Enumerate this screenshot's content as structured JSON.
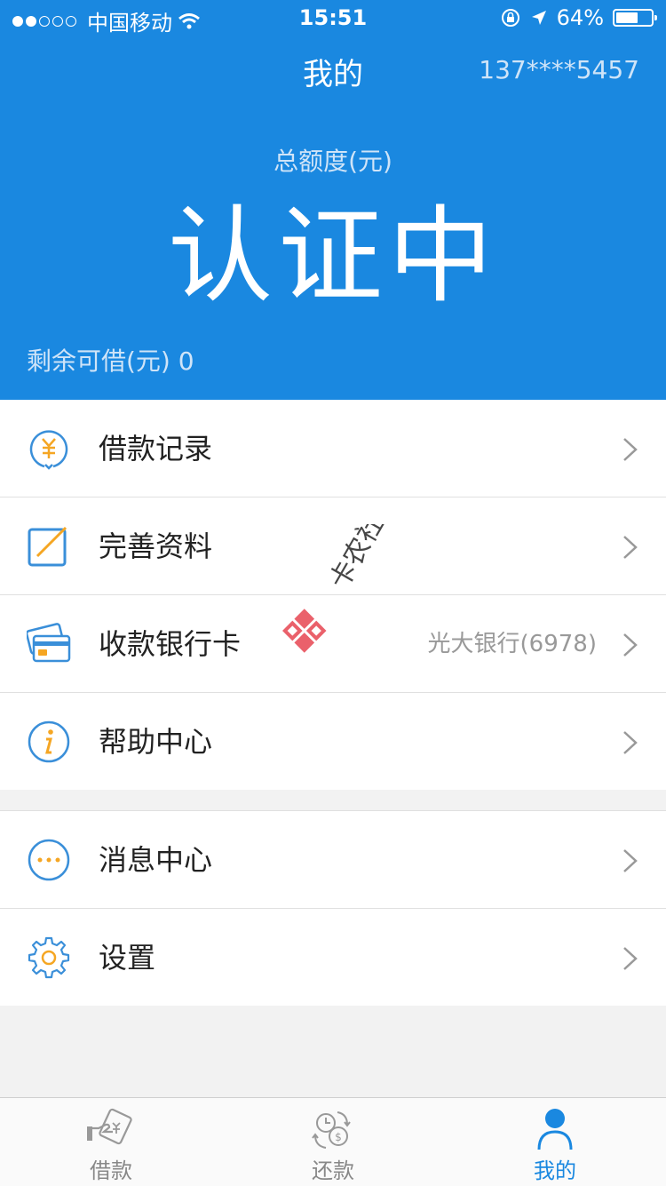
{
  "status_bar": {
    "carrier": "中国移动",
    "time": "15:51",
    "battery": "64%",
    "battery_level": 0.64
  },
  "nav": {
    "title": "我的",
    "phone": "137****5457"
  },
  "summary": {
    "quota_label": "总额度(元)",
    "quota_value": "认证中",
    "remaining_label": "剩余可借(元) 0"
  },
  "menu_group1": [
    {
      "label": "借款记录",
      "icon": "yuan-record-icon"
    },
    {
      "label": "完善资料",
      "icon": "edit-icon"
    },
    {
      "label": "收款银行卡",
      "icon": "bank-card-icon",
      "extra": "光大银行(6978)"
    },
    {
      "label": "帮助中心",
      "icon": "info-icon"
    }
  ],
  "menu_group2": [
    {
      "label": "消息中心",
      "icon": "message-icon"
    },
    {
      "label": "设置",
      "icon": "gear-icon"
    }
  ],
  "watermark": "卡农社区",
  "tabs": [
    {
      "label": "借款",
      "icon": "loan-icon",
      "active": false
    },
    {
      "label": "还款",
      "icon": "repay-icon",
      "active": false
    },
    {
      "label": "我的",
      "icon": "user-icon",
      "active": true
    }
  ],
  "colors": {
    "primary": "#1a88e0",
    "accent_orange": "#f5a623",
    "icon_blue": "#3a8fd9"
  }
}
